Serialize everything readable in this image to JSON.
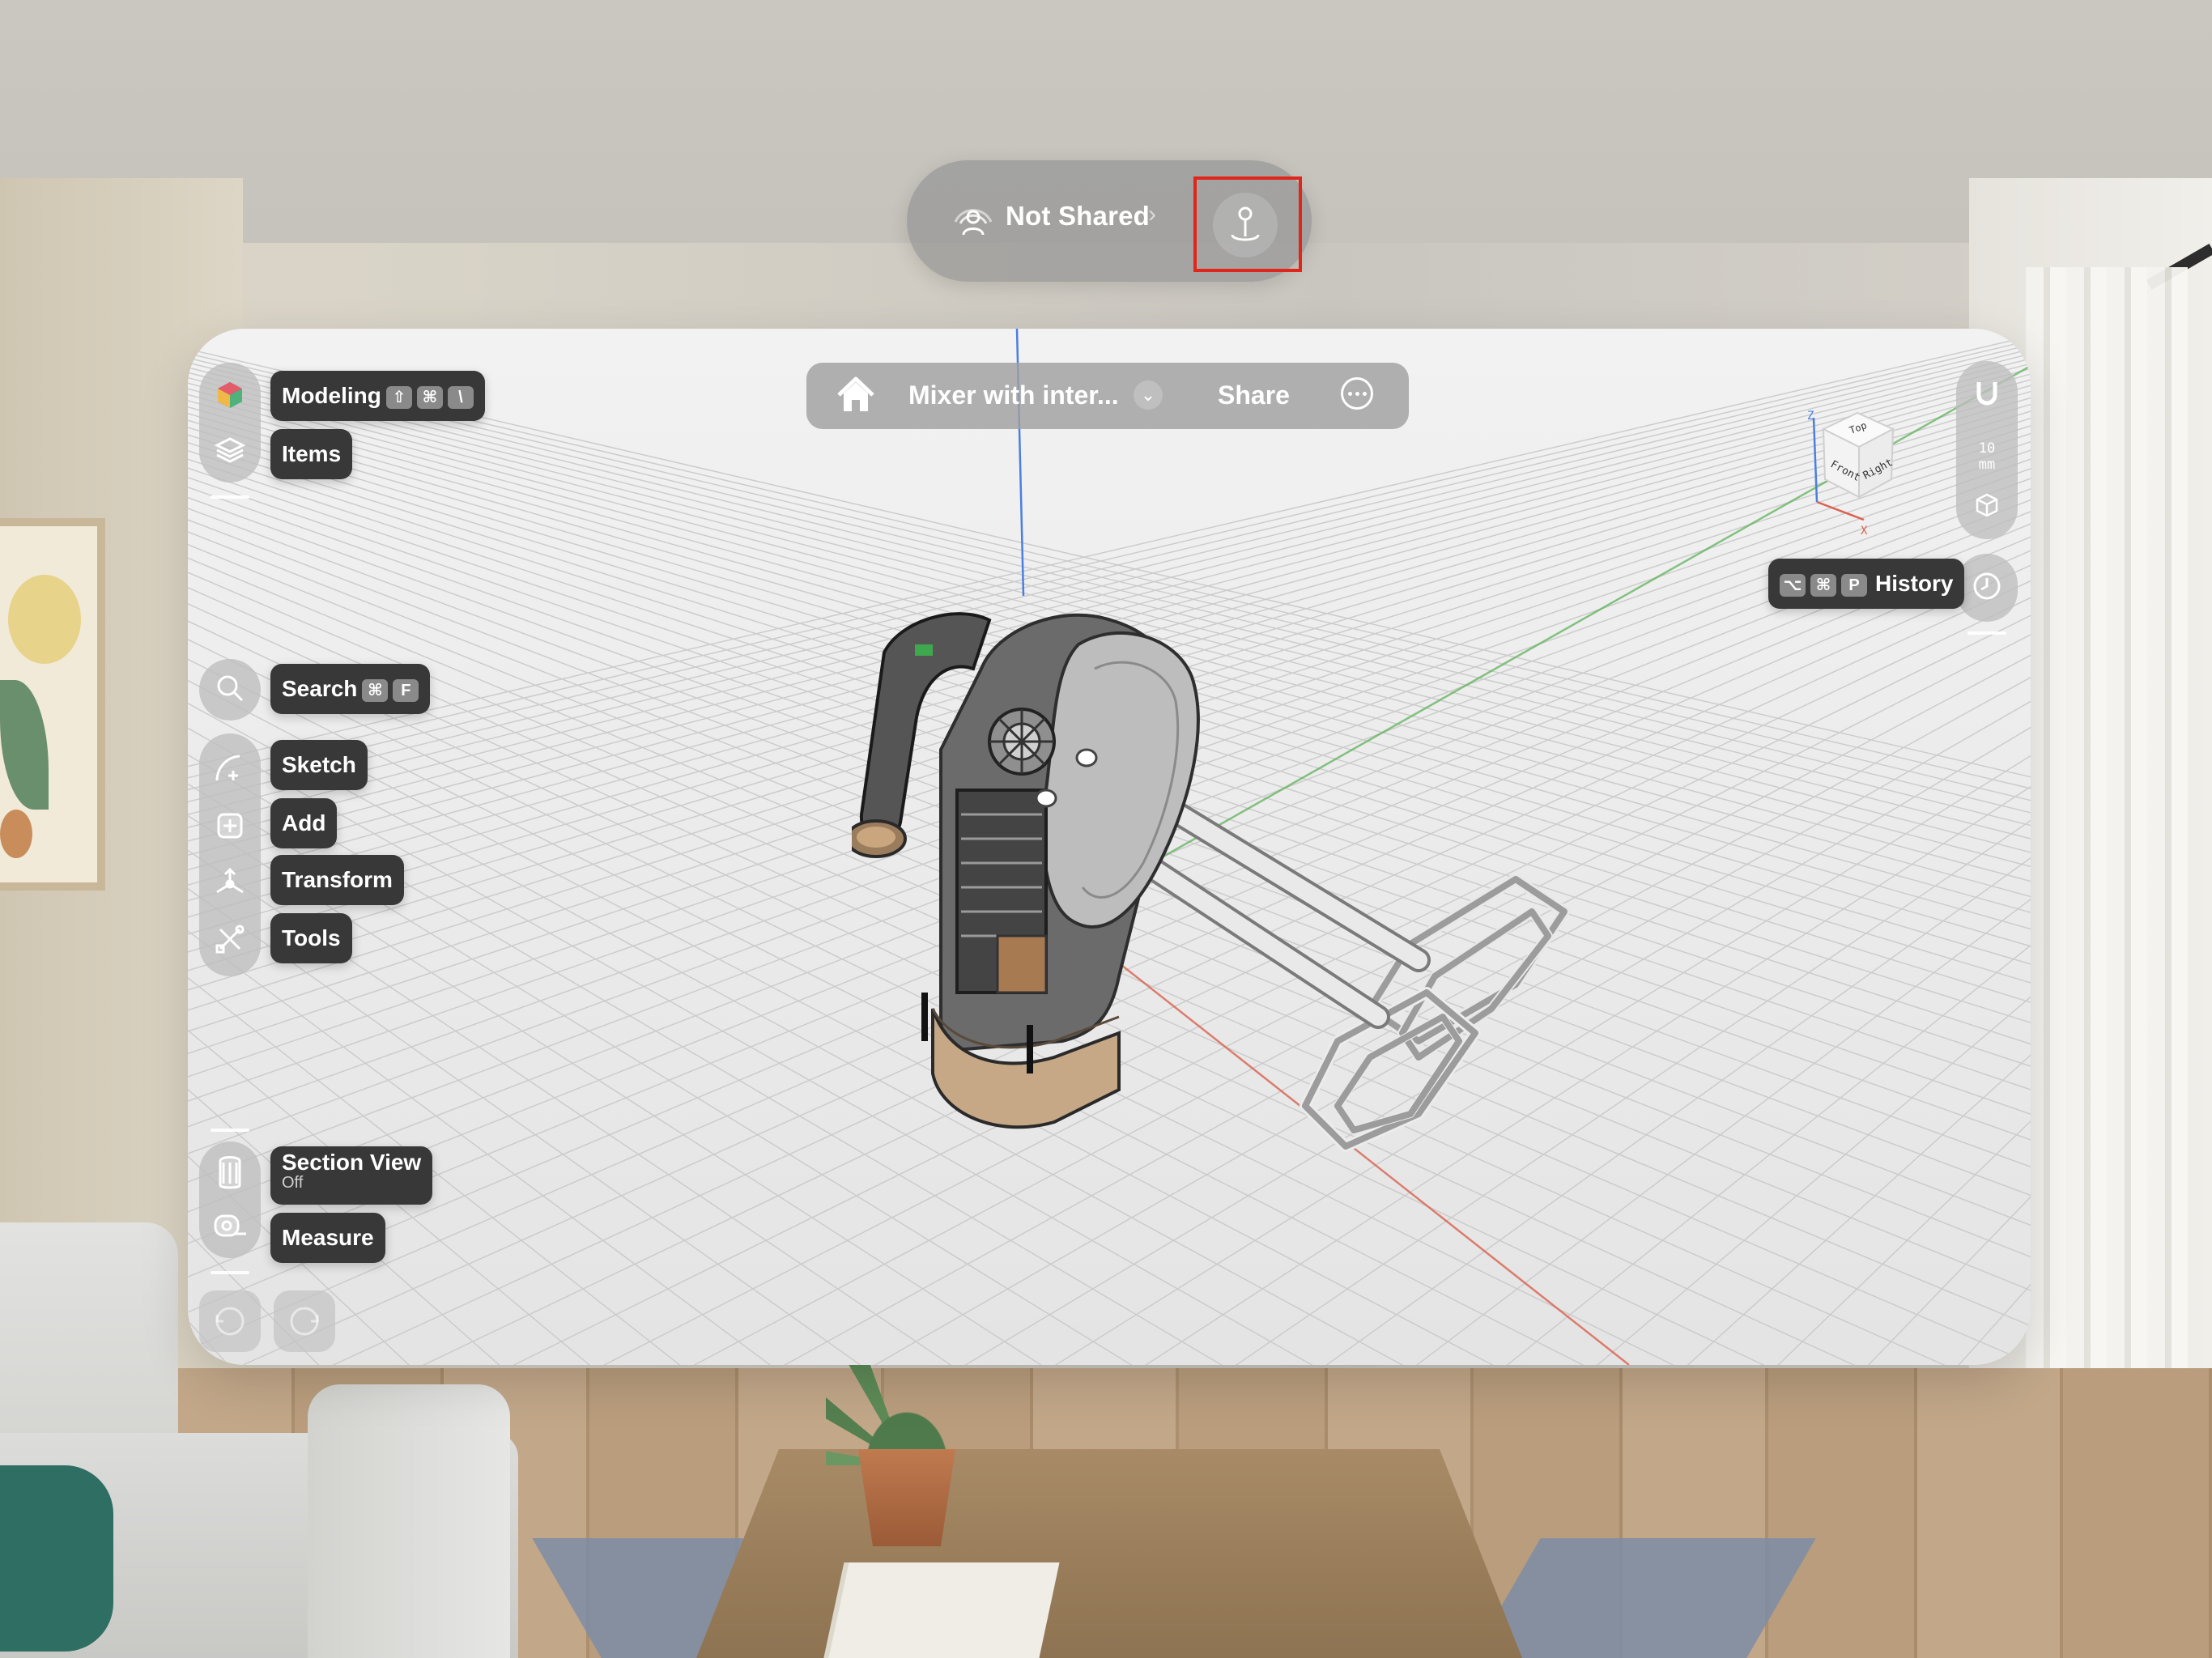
{
  "sharing": {
    "status": "Not Shared",
    "chevron": "›",
    "status_icon": "people-waves-icon",
    "pin_icon": "pin-icon"
  },
  "titlebar": {
    "home_icon": "house-icon",
    "document_title": "Mixer with inter...",
    "dropdown_icon": "chevron-down-icon",
    "share_label": "Share",
    "more_icon": "ellipsis-circle-icon"
  },
  "left_toolbar": {
    "modeling": {
      "label": "Modeling",
      "shortcut": [
        "⇧",
        "⌘",
        "\\"
      ]
    },
    "items": {
      "label": "Items"
    },
    "search": {
      "label": "Search",
      "shortcut": [
        "⌘",
        "F"
      ]
    },
    "sketch": {
      "label": "Sketch"
    },
    "add": {
      "label": "Add"
    },
    "transform": {
      "label": "Transform"
    },
    "tools": {
      "label": "Tools"
    },
    "section_view": {
      "label": "Section View",
      "sublabel": "Off"
    },
    "measure": {
      "label": "Measure"
    }
  },
  "right_toolbar": {
    "snap_icon": "magnet-icon",
    "units_value": "10",
    "units_unit": "mm",
    "cube_icon": "view-cube-icon",
    "history": {
      "label": "History",
      "shortcut": [
        "⌥",
        "⌘",
        "P"
      ]
    },
    "history_icon": "clock-icon"
  },
  "view_cube": {
    "faces": [
      "Top",
      "Front",
      "Right"
    ],
    "axes": [
      "Z",
      "X"
    ]
  },
  "colors": {
    "accent_red": "#e0261b",
    "axis_x": "#d9624f",
    "axis_y": "#5fb25a",
    "axis_z": "#4a7fe0",
    "label_bg": "#383838"
  }
}
